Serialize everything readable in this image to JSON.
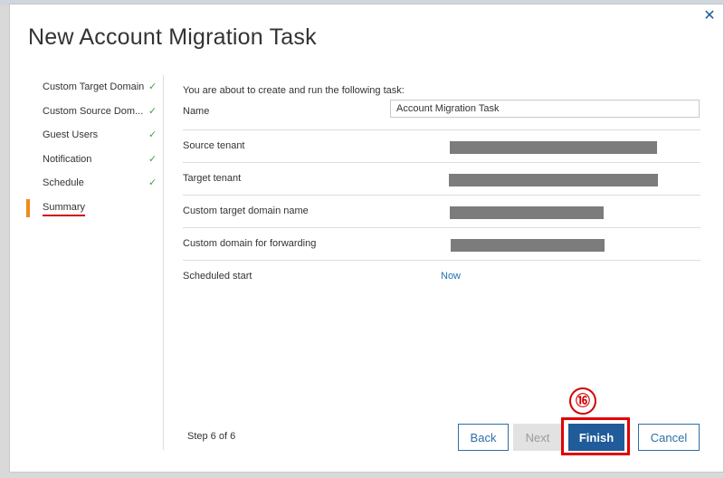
{
  "dialog": {
    "title": "New Account Migration Task",
    "close_icon": "close-icon"
  },
  "steps": [
    {
      "label": "Custom Target Domain",
      "done": true,
      "check": "✓"
    },
    {
      "label": "Custom Source Dom...",
      "done": true,
      "check": "✓"
    },
    {
      "label": "Guest Users",
      "done": true,
      "check": "✓"
    },
    {
      "label": "Notification",
      "done": true,
      "check": "✓"
    },
    {
      "label": "Schedule",
      "done": true,
      "check": "✓"
    },
    {
      "label": "Summary",
      "active": true
    }
  ],
  "summary": {
    "intro": "You are about to create and run the following task:",
    "name_label": "Name",
    "name_value": "Account Migration Task",
    "rows": [
      {
        "label": "Source tenant",
        "value": "",
        "redacted": true
      },
      {
        "label": "Target tenant",
        "value": "",
        "redacted": true
      },
      {
        "label": "Custom target domain name",
        "value": "",
        "redacted": true
      },
      {
        "label": "Custom domain for forwarding",
        "value": "",
        "redacted": true
      },
      {
        "label": "Scheduled start",
        "value": "Now",
        "redacted": false
      }
    ]
  },
  "footer": {
    "step_text": "Step 6 of 6",
    "back_label": "Back",
    "next_label": "Next",
    "finish_label": "Finish",
    "cancel_label": "Cancel"
  },
  "annotation": {
    "marker": "⑯"
  },
  "colors": {
    "accent_orange": "#f08a1f",
    "primary_blue": "#1f5c99",
    "check_green": "#3ea04a",
    "highlight_red": "#e00000"
  }
}
